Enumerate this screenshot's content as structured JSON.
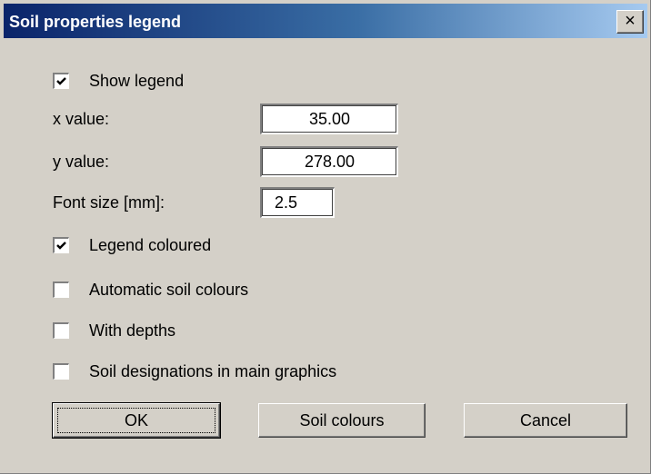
{
  "dialog": {
    "title": "Soil properties legend",
    "close_glyph": "×"
  },
  "show_legend": {
    "label": "Show legend",
    "checked": true
  },
  "fields": {
    "x_label": "x value:",
    "x_value": "35.00",
    "y_label": "y value:",
    "y_value": "278.00",
    "font_label": "Font size [mm]:",
    "font_value": "2.5"
  },
  "options": {
    "legend_coloured": {
      "label": "Legend coloured",
      "checked": true
    },
    "automatic_colours": {
      "label": "Automatic soil colours",
      "checked": false
    },
    "with_depths": {
      "label": "With depths",
      "checked": false
    },
    "soil_designations": {
      "label": "Soil designations in main graphics",
      "checked": false
    }
  },
  "buttons": {
    "ok": "OK",
    "soil_colours": "Soil colours",
    "cancel": "Cancel"
  },
  "colors": {
    "face": "#d4d0c8",
    "title_start": "#0a246a",
    "title_end": "#a6caf0"
  },
  "icons": {
    "close": "close-icon",
    "check": "checkmark-icon"
  }
}
